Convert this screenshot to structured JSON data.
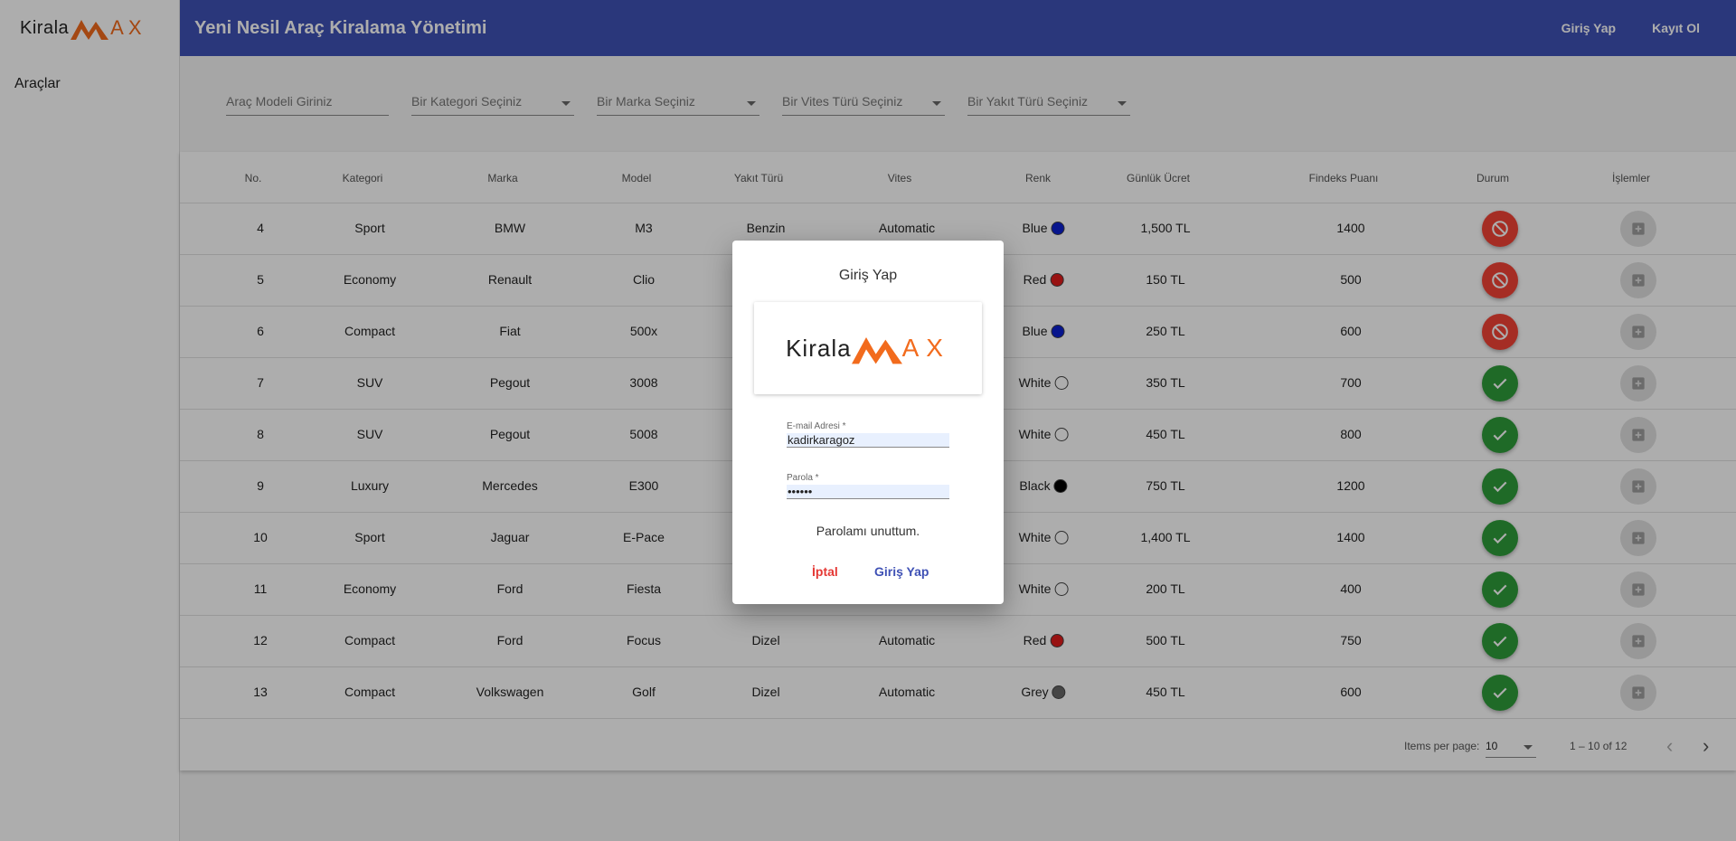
{
  "brand": {
    "text": "Kirala",
    "suffix": "AX"
  },
  "sidebar": {
    "items": [
      {
        "label": "Araçlar"
      }
    ]
  },
  "header": {
    "title": "Yeni Nesil Araç Kiralama Yönetimi",
    "login_label": "Giriş Yap",
    "register_label": "Kayıt Ol"
  },
  "filters": {
    "model_placeholder": "Araç Modeli Giriniz",
    "category_placeholder": "Bir Kategori Seçiniz",
    "brand_placeholder": "Bir Marka Seçiniz",
    "gear_placeholder": "Bir Vites Türü Seçiniz",
    "fuel_placeholder": "Bir Yakıt Türü Seçiniz"
  },
  "table": {
    "headers": [
      "No.",
      "Kategori",
      "Marka",
      "Model",
      "Yakıt Türü",
      "Vites",
      "Renk",
      "Günlük Ücret",
      "Findeks Puanı",
      "Durum",
      "İşlemler"
    ],
    "rows": [
      {
        "no": "4",
        "category": "Sport",
        "brand": "BMW",
        "model": "M3",
        "fuel": "Benzin",
        "gear": "Automatic",
        "color": "Blue",
        "color_hex": "#0b1fd0",
        "price": "1,500 TL",
        "findeks": "1400",
        "status": "unavailable"
      },
      {
        "no": "5",
        "category": "Economy",
        "brand": "Renault",
        "model": "Clio",
        "fuel": "",
        "gear": "",
        "color": "Red",
        "color_hex": "#e01b1b",
        "price": "150 TL",
        "findeks": "500",
        "status": "unavailable"
      },
      {
        "no": "6",
        "category": "Compact",
        "brand": "Fiat",
        "model": "500x",
        "fuel": "",
        "gear": "",
        "color": "Blue",
        "color_hex": "#0b1fd0",
        "price": "250 TL",
        "findeks": "600",
        "status": "unavailable"
      },
      {
        "no": "7",
        "category": "SUV",
        "brand": "Pegout",
        "model": "3008",
        "fuel": "",
        "gear": "",
        "color": "White",
        "color_hex": "#ffffff",
        "price": "350 TL",
        "findeks": "700",
        "status": "available"
      },
      {
        "no": "8",
        "category": "SUV",
        "brand": "Pegout",
        "model": "5008",
        "fuel": "",
        "gear": "",
        "color": "White",
        "color_hex": "#ffffff",
        "price": "450 TL",
        "findeks": "800",
        "status": "available"
      },
      {
        "no": "9",
        "category": "Luxury",
        "brand": "Mercedes",
        "model": "E300",
        "fuel": "",
        "gear": "",
        "color": "Black",
        "color_hex": "#000000",
        "price": "750 TL",
        "findeks": "1200",
        "status": "available"
      },
      {
        "no": "10",
        "category": "Sport",
        "brand": "Jaguar",
        "model": "E-Pace",
        "fuel": "",
        "gear": "",
        "color": "White",
        "color_hex": "#ffffff",
        "price": "1,400 TL",
        "findeks": "1400",
        "status": "available"
      },
      {
        "no": "11",
        "category": "Economy",
        "brand": "Ford",
        "model": "Fiesta",
        "fuel": "",
        "gear": "",
        "color": "White",
        "color_hex": "#ffffff",
        "price": "200 TL",
        "findeks": "400",
        "status": "available"
      },
      {
        "no": "12",
        "category": "Compact",
        "brand": "Ford",
        "model": "Focus",
        "fuel": "Dizel",
        "gear": "Automatic",
        "color": "Red",
        "color_hex": "#e01b1b",
        "price": "500 TL",
        "findeks": "750",
        "status": "available"
      },
      {
        "no": "13",
        "category": "Compact",
        "brand": "Volkswagen",
        "model": "Golf",
        "fuel": "Dizel",
        "gear": "Automatic",
        "color": "Grey",
        "color_hex": "#666666",
        "price": "450 TL",
        "findeks": "600",
        "status": "available"
      }
    ]
  },
  "paginator": {
    "items_per_page_label": "Items per page:",
    "page_size": "10",
    "range_label": "1 – 10 of 12"
  },
  "dialog": {
    "title": "Giriş Yap",
    "email_label": "E-mail Adresi *",
    "email_value": "kadirkaragoz",
    "password_label": "Parola *",
    "password_value": "••••••",
    "forgot_label": "Parolamı unuttum.",
    "cancel_label": "İptal",
    "submit_label": "Giriş Yap"
  },
  "colors": {
    "primary": "#3f51b5",
    "brand_orange": "#f26b1d",
    "status_red": "#f44336",
    "status_green": "#2e9d3a",
    "cancel_red": "#e53935"
  }
}
